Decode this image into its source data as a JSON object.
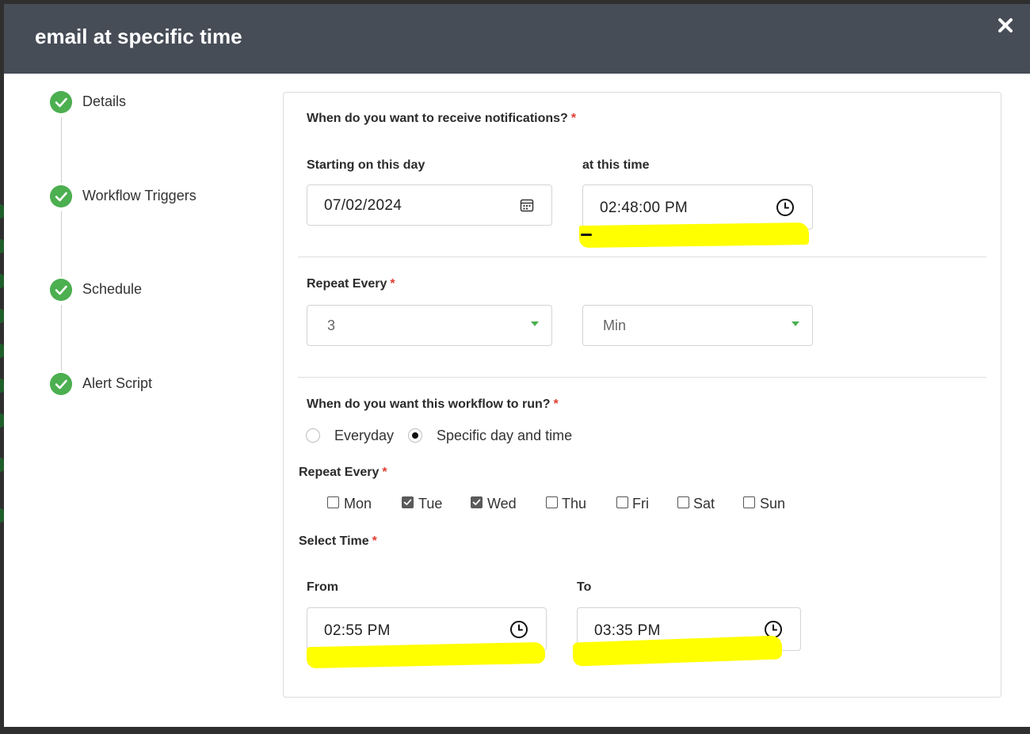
{
  "modal": {
    "title": "email at specific time"
  },
  "stepper": {
    "steps": [
      {
        "label": "Details"
      },
      {
        "label": "Workflow Triggers"
      },
      {
        "label": "Schedule"
      },
      {
        "label": "Alert Script"
      }
    ]
  },
  "notify": {
    "question": "When do you want to receive notifications?",
    "required_mark": "*",
    "start_day_label": "Starting on this day",
    "start_day_value": "07/02/2024",
    "time_label": "at this time",
    "time_value": "02:48:00 PM"
  },
  "repeat": {
    "label": "Repeat Every",
    "required_mark": "*",
    "interval_value": "3",
    "unit_value": "Min"
  },
  "run": {
    "question": "When do you want this workflow to run?",
    "required_mark": "*",
    "options": [
      {
        "label": "Everyday",
        "selected": false
      },
      {
        "label": "Specific day and time",
        "selected": true
      }
    ]
  },
  "days": {
    "label": "Repeat Every",
    "required_mark": "*",
    "items": [
      {
        "label": "Mon",
        "checked": false
      },
      {
        "label": "Tue",
        "checked": true
      },
      {
        "label": "Wed",
        "checked": true
      },
      {
        "label": "Thu",
        "checked": false
      },
      {
        "label": "Fri",
        "checked": false
      },
      {
        "label": "Sat",
        "checked": false
      },
      {
        "label": "Sun",
        "checked": false
      }
    ]
  },
  "select_time": {
    "label": "Select Time",
    "required_mark": "*",
    "from_label": "From",
    "from_value": "02:55 PM",
    "to_label": "To",
    "to_value": "03:35 PM"
  },
  "colors": {
    "header_bg": "#474d57",
    "step_done": "#4caf50",
    "required": "#e03c31",
    "highlight": "#ffff00"
  }
}
